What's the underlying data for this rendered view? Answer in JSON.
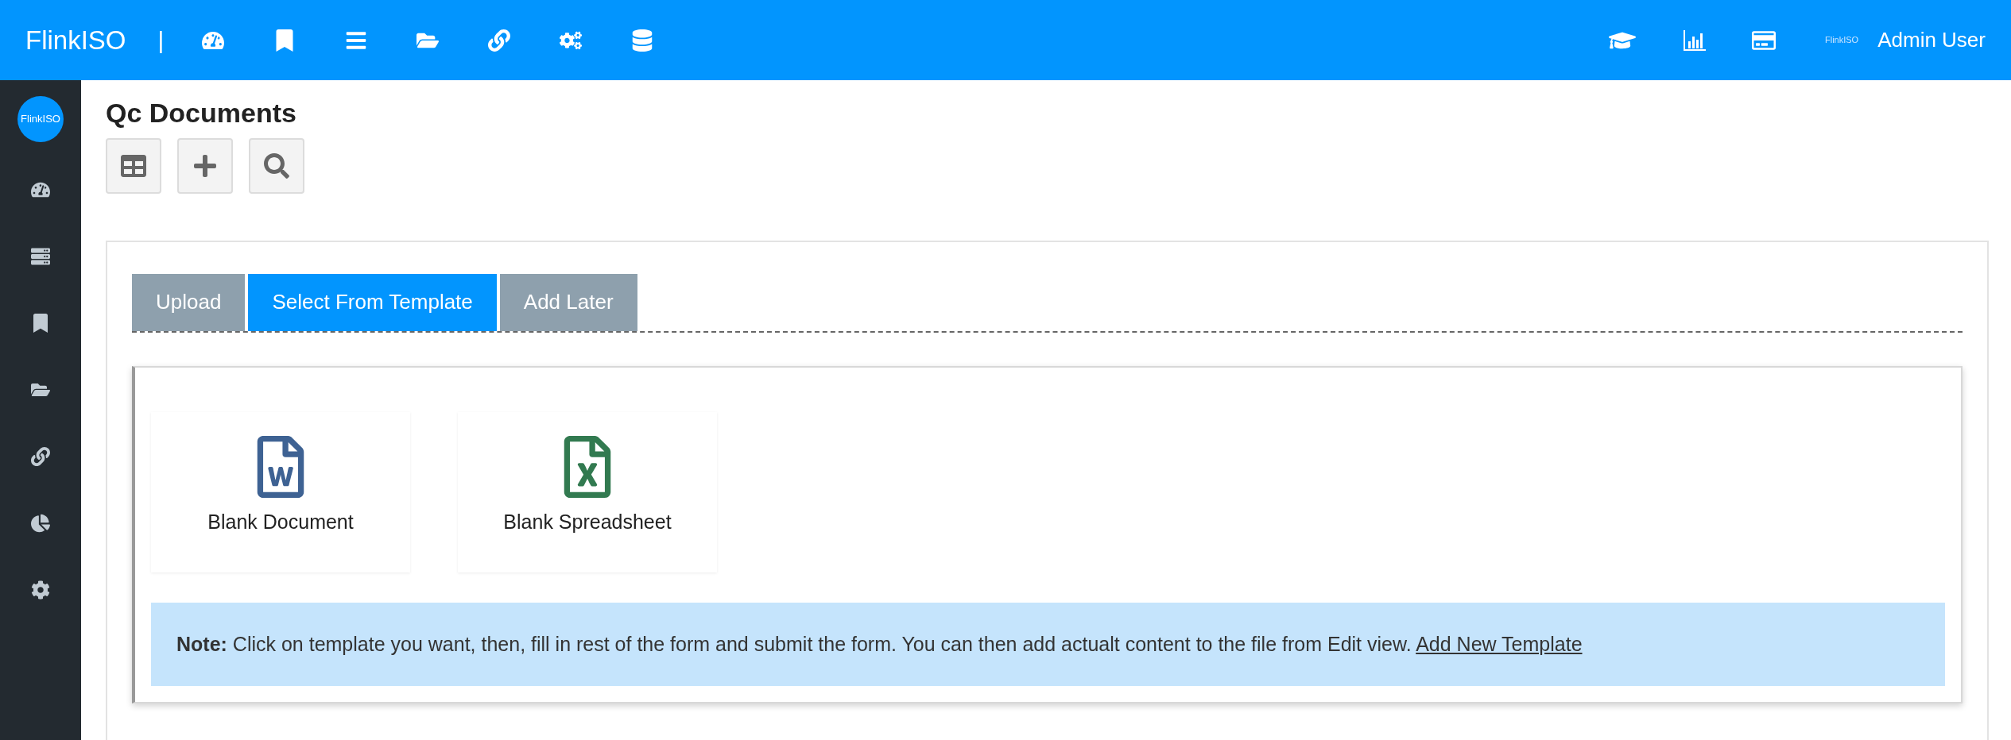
{
  "navbar": {
    "brand": "FlinkISO",
    "separator": "|",
    "small_logo": "FlinkISO",
    "user": "Admin User"
  },
  "sidebar": {
    "logo": "FlinkISO"
  },
  "page": {
    "title": "Qc Documents"
  },
  "tabs": [
    {
      "label": "Upload",
      "selected": false
    },
    {
      "label": "Select From Template",
      "selected": true
    },
    {
      "label": "Add Later",
      "selected": false
    }
  ],
  "templates": [
    {
      "kind": "word",
      "label": "Blank Document"
    },
    {
      "kind": "excel",
      "label": "Blank Spreadsheet"
    }
  ],
  "note": {
    "text": "**Note:** Click on template you want, then, fill in rest of the form and submit the form. You can then add actualt content to the file from Edit view.",
    "link": "Add New Template"
  }
}
